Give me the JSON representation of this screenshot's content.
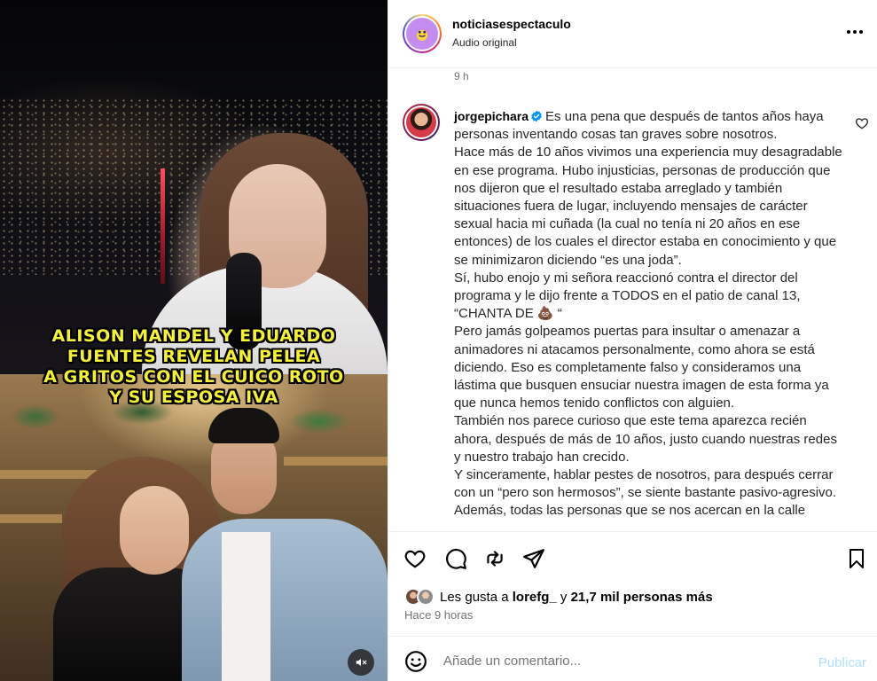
{
  "media": {
    "caption_lines": [
      "ALISON MANDEL Y EDUARDO",
      "FUENTES REVELAN PELEA",
      "A GRITOS CON EL CUICO ROTO",
      "Y SU ESPOSA IVA"
    ],
    "mute_icon": "speaker-muted-icon"
  },
  "post": {
    "username": "noticiasespectaculo",
    "audio_label": "Audio original",
    "more_icon": "more-options-icon"
  },
  "comments": {
    "previous_time": "9 h",
    "main": {
      "username": "jorgepichara",
      "verified": true,
      "text": "Es una pena que después de tantos años haya personas inventando cosas tan graves sobre nosotros.\nHace más de 10 años vivimos una experiencia muy desagradable en ese programa. Hubo injusticias, personas de producción que nos dijeron que el resultado estaba arreglado y también situaciones fuera de lugar, incluyendo mensajes de carácter sexual hacia mi cuñada (la cual no tenía ni 20 años en ese entonces) de los cuales el director estaba en conocimiento y que se minimizaron diciendo “es una joda”.\nSí, hubo enojo y mi señora reaccionó contra el director del programa y le dijo frente a TODOS en el patio de canal 13, “CHANTA DE 💩 “\nPero jamás golpeamos puertas para insultar o amenazar a animadores ni atacamos personalmente, como ahora se está diciendo. Eso es completamente falso y consideramos una lástima que busquen ensuciar nuestra imagen de esta forma ya que nunca hemos tenido conflictos con alguien.\nTambién nos parece curioso que este tema aparezca recién ahora, después de más de 10 años, justo cuando nuestras redes y nuestro trabajo han crecido.\nY sinceramente, hablar pestes de nosotros, para después cerrar con un “pero son hermosos”, se siente bastante pasivo-agresivo.\nAdemás, todas las personas que se nos acercan en la calle"
    }
  },
  "actions": {
    "like_icon": "heart-icon",
    "comment_icon": "comment-icon",
    "repost_icon": "repost-icon",
    "share_icon": "share-icon",
    "save_icon": "bookmark-icon"
  },
  "likes": {
    "prefix": "Les gusta a ",
    "user": "lorefg_",
    "connector": " y ",
    "others": "21,7 mil personas más",
    "posted_time": "Hace 9 horas"
  },
  "add_comment": {
    "placeholder": "Añade un comentario...",
    "publish_label": "Publicar"
  }
}
